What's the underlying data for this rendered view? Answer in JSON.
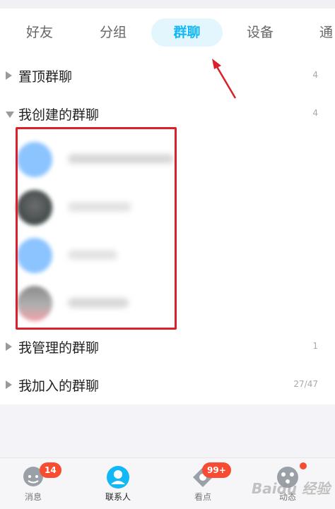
{
  "tabs": [
    {
      "label": "好友",
      "active": false
    },
    {
      "label": "分组",
      "active": false
    },
    {
      "label": "群聊",
      "active": true
    },
    {
      "label": "设备",
      "active": false
    },
    {
      "label": "通",
      "active": false
    }
  ],
  "groups": [
    {
      "label": "置顶群聊",
      "count": "4",
      "expanded": false
    },
    {
      "label": "我创建的群聊",
      "count": "4",
      "expanded": true
    },
    {
      "label": "我管理的群聊",
      "count": "1",
      "expanded": false
    },
    {
      "label": "我加入的群聊",
      "count": "27/47",
      "expanded": false
    }
  ],
  "created_groups_count_shown": 4,
  "bottom_nav": [
    {
      "label": "消息",
      "badge": "14",
      "icon": "chat-bubble-icon"
    },
    {
      "label": "联系人",
      "badge": "",
      "icon": "contacts-person-icon",
      "active": true
    },
    {
      "label": "看点",
      "badge": "99+",
      "icon": "view-diamond-icon"
    },
    {
      "label": "动态",
      "badge": "",
      "icon": "star-dynamic-icon",
      "dot": true
    }
  ],
  "watermark": "Baidu 经验",
  "colors": {
    "accent": "#12b7f5",
    "accent_bg": "#e3f6fd",
    "badge": "#f74c31",
    "annotation": "#d9202b"
  }
}
